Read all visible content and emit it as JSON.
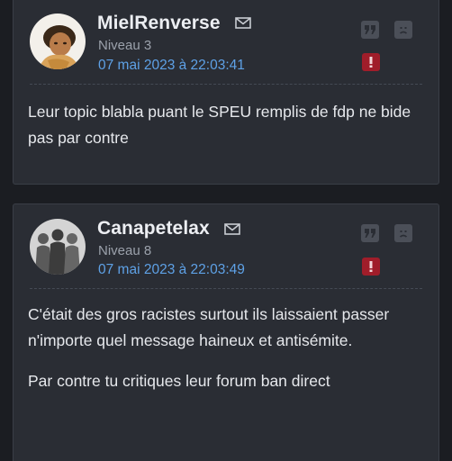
{
  "posts": [
    {
      "author": "MielRenverse",
      "level": "Niveau 3",
      "date": "07 mai 2023 à 22:03:41",
      "message": [
        "Leur topic blabla puant le SPEU remplis de fdp ne bide pas par contre"
      ]
    },
    {
      "author": "Canapetelax",
      "level": "Niveau 8",
      "date": "07 mai 2023 à 22:03:49",
      "message": [
        "C'était des gros racistes surtout ils laissaient passer n'importe quel message haineux et antisémite.",
        "Par contre tu critiques leur forum ban direct"
      ]
    }
  ],
  "icons": {
    "mail": "mail-icon",
    "quote": "quote-icon",
    "private_message": "frown-face-icon",
    "alert": "exclamation-icon"
  },
  "colors": {
    "background": "#1b1d22",
    "card": "#2a2d34",
    "date_link": "#5ea1e6",
    "alert": "#a01d2a"
  }
}
